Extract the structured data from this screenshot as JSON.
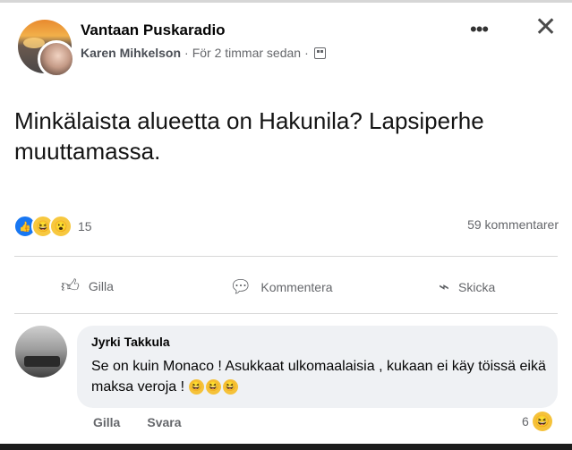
{
  "post": {
    "group_name": "Vantaan Puskaradio",
    "author": "Karen Mihkelson",
    "timestamp": "För 2 timmar sedan",
    "separator": "·",
    "text": "Minkälaista alueetta on Hakunila? Lapsiperhe muuttamassa.",
    "more_label": "•••",
    "close_label": "✕"
  },
  "stats": {
    "reaction_count": "15",
    "comment_count": "59 kommentarer",
    "reactions": [
      "like-icon",
      "haha-icon",
      "wow-icon"
    ]
  },
  "actions": {
    "like": "Gilla",
    "comment": "Kommentera",
    "send": "Skicka"
  },
  "comment": {
    "author": "Jyrki Takkula",
    "text": "Se on kuin Monaco ! Asukkaat ulkomaalaisia , kukaan ei käy töissä eikä maksa veroja !",
    "emojis": [
      "laughing-emoji",
      "laughing-emoji",
      "laughing-emoji"
    ],
    "like_label": "Gilla",
    "reply_label": "Svara",
    "reaction_count": "6"
  },
  "colors": {
    "link_blue": "#1877f2",
    "muted_text": "#65676b",
    "bubble_bg": "#eff1f4"
  }
}
